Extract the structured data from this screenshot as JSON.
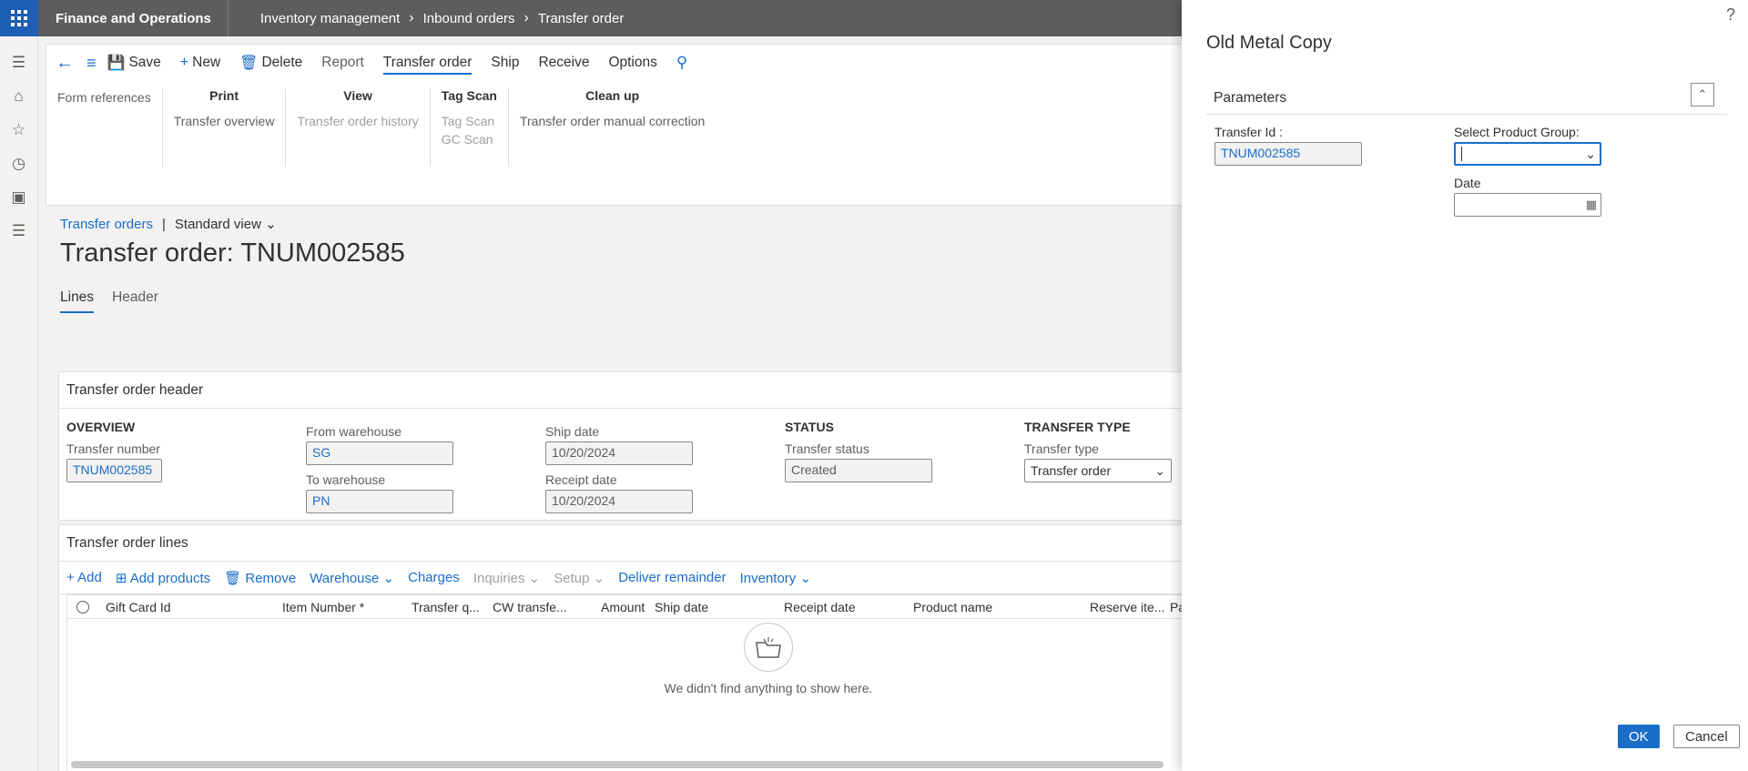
{
  "app": {
    "name": "Finance and Operations"
  },
  "breadcrumbs": [
    "Inventory management",
    "Inbound orders",
    "Transfer order"
  ],
  "toolbar": {
    "save": "Save",
    "new": "New",
    "delete": "Delete",
    "report": "Report",
    "transfer_order": "Transfer order",
    "ship": "Ship",
    "receive": "Receive",
    "options": "Options"
  },
  "ribbon": {
    "form_references": "Form references",
    "print": {
      "title": "Print",
      "items": [
        "Transfer overview"
      ]
    },
    "view": {
      "title": "View",
      "items": [
        "Transfer order history"
      ]
    },
    "tag_scan": {
      "title": "Tag Scan",
      "items": [
        "Tag Scan",
        "GC Scan"
      ]
    },
    "clean_up": {
      "title": "Clean up",
      "items": [
        "Transfer order manual correction"
      ]
    }
  },
  "view": {
    "link": "Transfer orders",
    "standard_view": "Standard view"
  },
  "page": {
    "title": "Transfer order: TNUM002585"
  },
  "tabs": [
    "Lines",
    "Header"
  ],
  "header_card": {
    "title": "Transfer order header",
    "overview": {
      "section": "OVERVIEW",
      "label": "Transfer number",
      "value": "TNUM002585"
    },
    "from_warehouse": {
      "label": "From warehouse",
      "value": "SG"
    },
    "to_warehouse": {
      "label": "To warehouse",
      "value": "PN"
    },
    "ship_date": {
      "label": "Ship date",
      "value": "10/20/2024"
    },
    "receipt_date": {
      "label": "Receipt date",
      "value": "10/20/2024"
    },
    "status": {
      "section": "STATUS",
      "label": "Transfer status",
      "value": "Created"
    },
    "transfer_type": {
      "section": "TRANSFER TYPE",
      "label": "Transfer type",
      "value": "Transfer order"
    }
  },
  "lines_card": {
    "title": "Transfer order lines",
    "actions": {
      "add": "Add",
      "add_products": "Add products",
      "remove": "Remove",
      "warehouse": "Warehouse",
      "charges": "Charges",
      "inquiries": "Inquiries",
      "setup": "Setup",
      "deliver_remainder": "Deliver remainder",
      "inventory": "Inventory"
    },
    "columns": [
      "Gift Card Id",
      "Item Number *",
      "Transfer q...",
      "CW transfe...",
      "Amount",
      "Ship date",
      "Receipt date",
      "Product name",
      "Reserve ite...",
      "Pac"
    ],
    "empty_message": "We didn't find anything to show here."
  },
  "dialog": {
    "title": "Old Metal Copy",
    "help": "?",
    "section": "Parameters",
    "transfer_id": {
      "label": "Transfer Id :",
      "value": "TNUM002585"
    },
    "product_group": {
      "label": "Select Product Group:",
      "value": ""
    },
    "date": {
      "label": "Date",
      "value": ""
    },
    "ok": "OK",
    "cancel": "Cancel"
  }
}
